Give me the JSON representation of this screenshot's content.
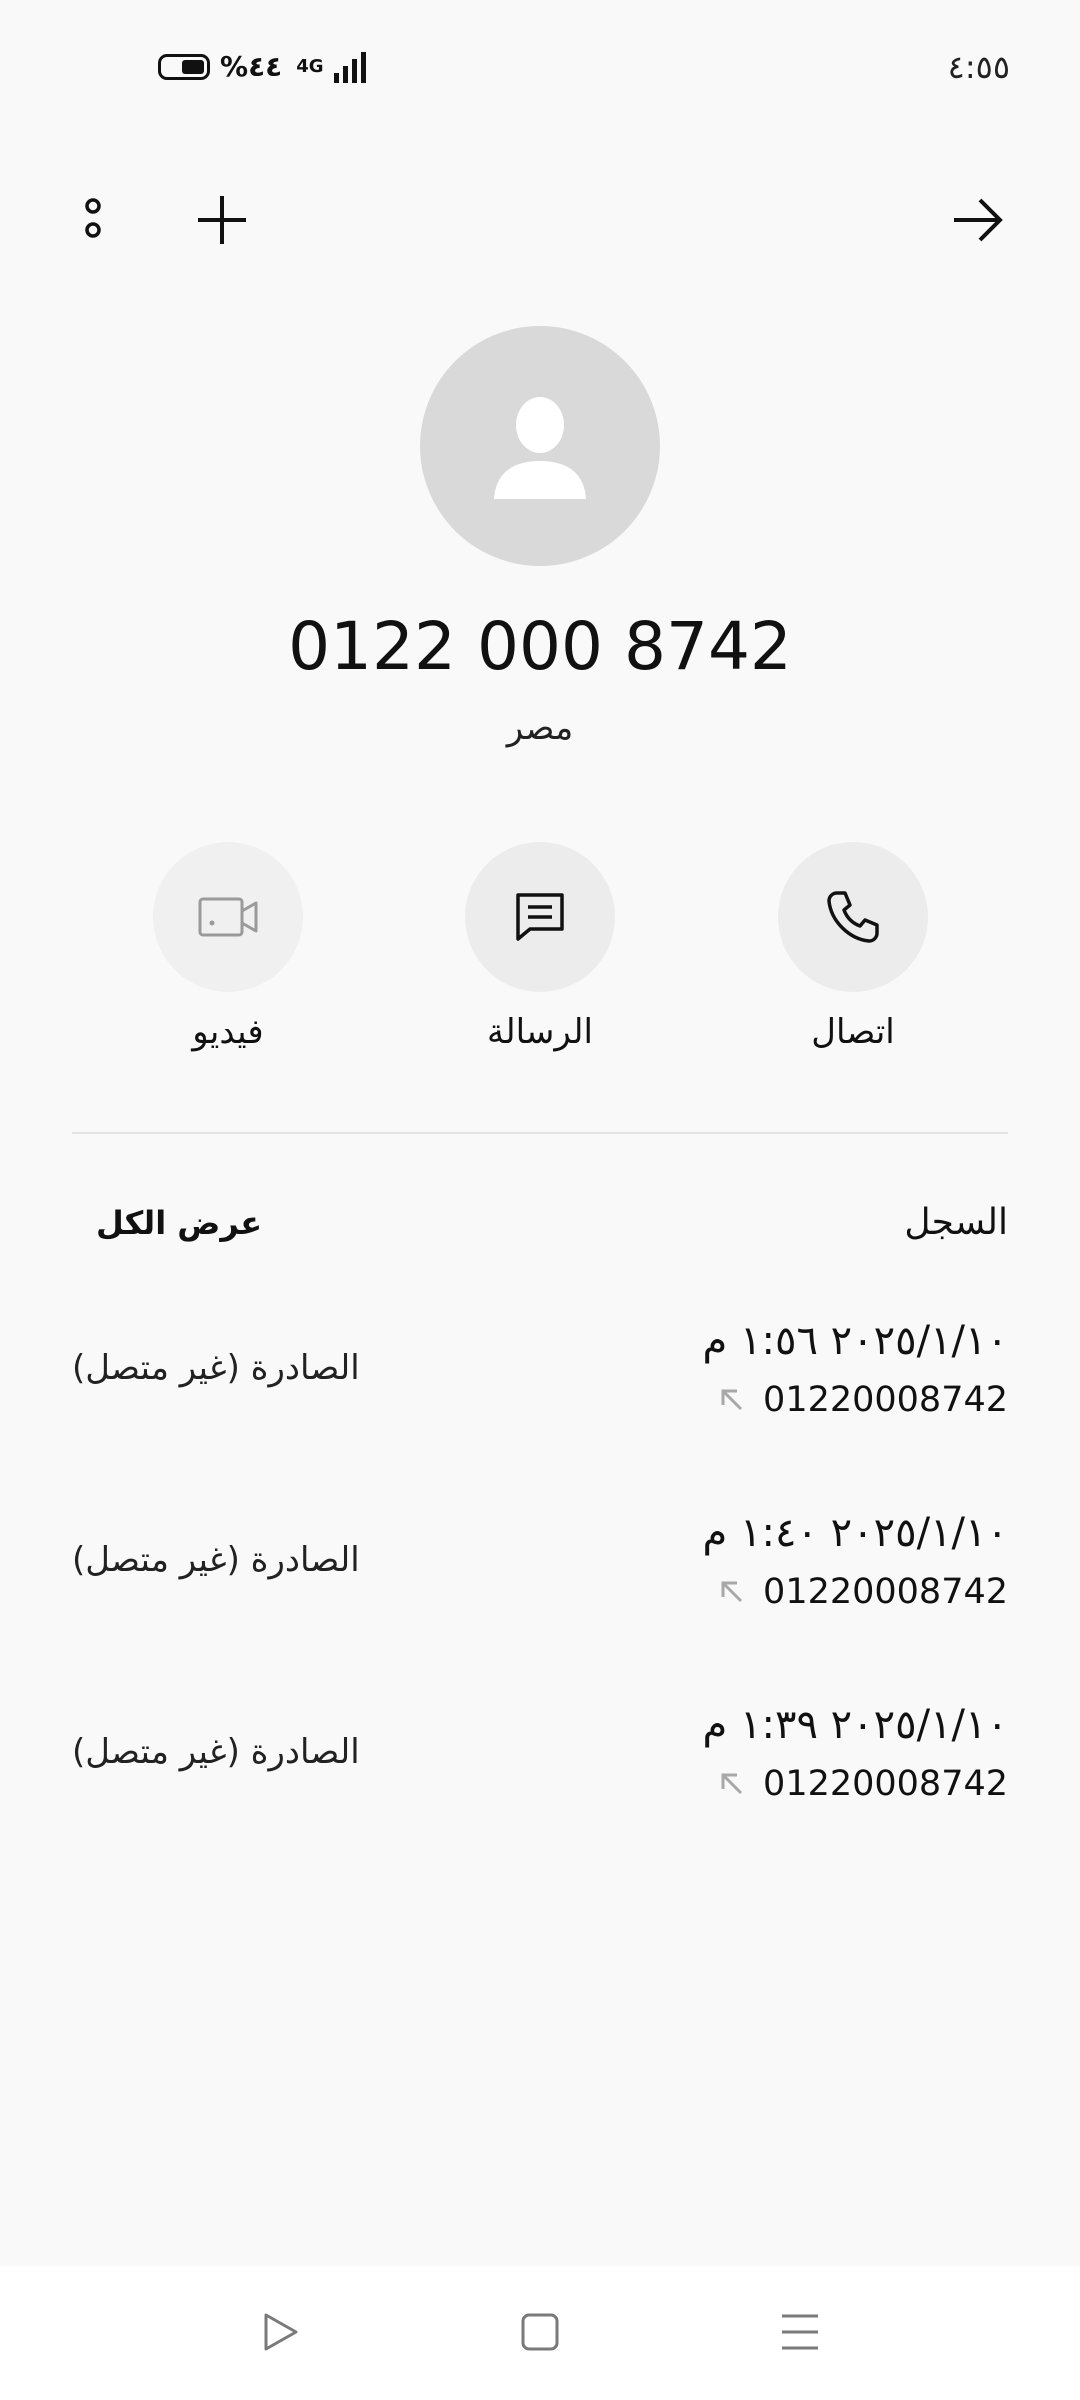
{
  "status_bar": {
    "time": "٤:٥٥",
    "battery": "%٤٤",
    "network": "4G"
  },
  "contact": {
    "number": "0122 000 8742",
    "country": "مصر"
  },
  "actions": {
    "call": "اتصال",
    "message": "الرسالة",
    "video": "فيديو"
  },
  "log": {
    "title": "السجل",
    "view_all": "عرض الكل",
    "entries": [
      {
        "date": "٢٠٢٥/١/١٠ ١:٥٦ م",
        "number": "01220008742",
        "status": "الصادرة (غير متصل)"
      },
      {
        "date": "٢٠٢٥/١/١٠ ١:٤٠ م",
        "number": "01220008742",
        "status": "الصادرة (غير متصل)"
      },
      {
        "date": "٢٠٢٥/١/١٠ ١:٣٩ م",
        "number": "01220008742",
        "status": "الصادرة (غير متصل)"
      }
    ]
  },
  "icons": {
    "more": "more-vertical-icon",
    "add": "plus-icon",
    "forward": "arrow-right-icon",
    "avatar": "person-icon",
    "call": "phone-icon",
    "message": "message-icon",
    "video": "video-camera-icon",
    "outgoing": "outgoing-arrow-icon",
    "nav_back": "triangle-back-icon",
    "nav_home": "square-home-icon",
    "nav_recents": "menu-lines-icon"
  },
  "colors": {
    "background": "#f9f9f9",
    "button_bg": "#ececec",
    "avatar_bg": "#d9d9d9"
  }
}
